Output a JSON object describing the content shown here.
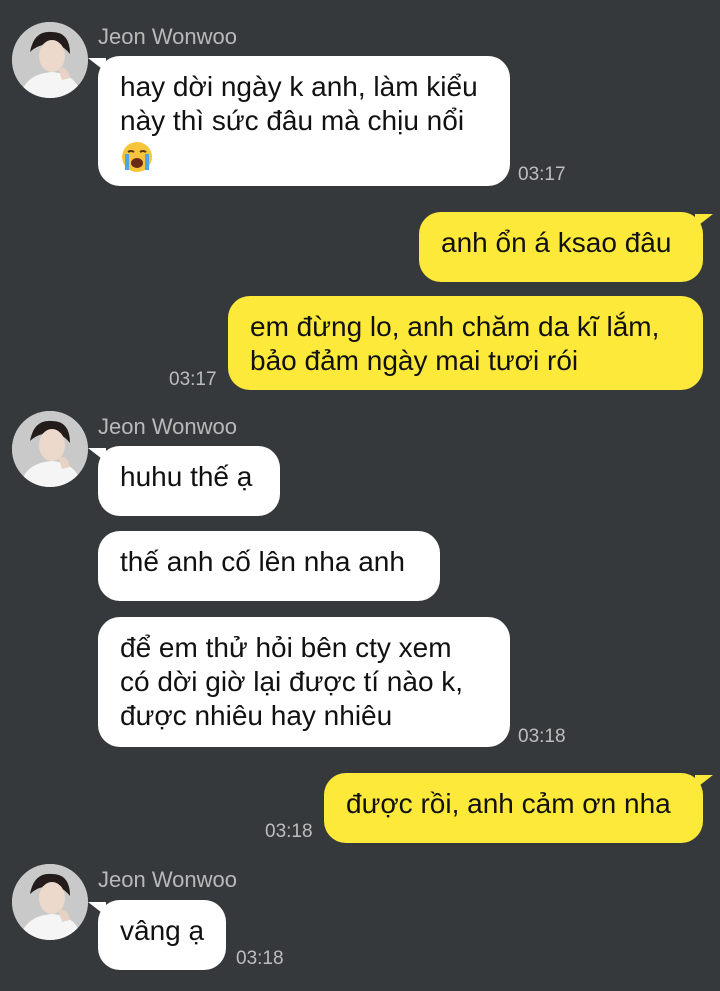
{
  "contact": {
    "name": "Jeon Wonwoo"
  },
  "messages": [
    {
      "lines": [
        "hay dời ngày k anh, làm kiểu",
        "này thì sức đâu mà chịu nổi"
      ],
      "emoji": "loudly-crying-face",
      "time": "03:17"
    },
    {
      "lines": [
        "anh ổn á ksao đâu"
      ]
    },
    {
      "lines": [
        "em đừng lo, anh chăm da kĩ lắm,",
        "bảo đảm ngày mai tươi rói"
      ],
      "time": "03:17"
    },
    {
      "lines": [
        "huhu thế ạ"
      ]
    },
    {
      "lines": [
        "thế anh cố lên nha anh"
      ]
    },
    {
      "lines": [
        "để em thử hỏi bên cty xem",
        "có dời giờ lại được tí nào k,",
        "được nhiêu hay nhiêu"
      ],
      "time": "03:18"
    },
    {
      "lines": [
        "được rồi, anh cảm ơn nha"
      ],
      "time": "03:18"
    },
    {
      "lines": [
        "vâng ạ"
      ],
      "time": "03:18"
    }
  ],
  "colors": {
    "background": "#36393b",
    "incoming_bubble": "#ffffff",
    "outgoing_bubble": "#fde93a"
  }
}
